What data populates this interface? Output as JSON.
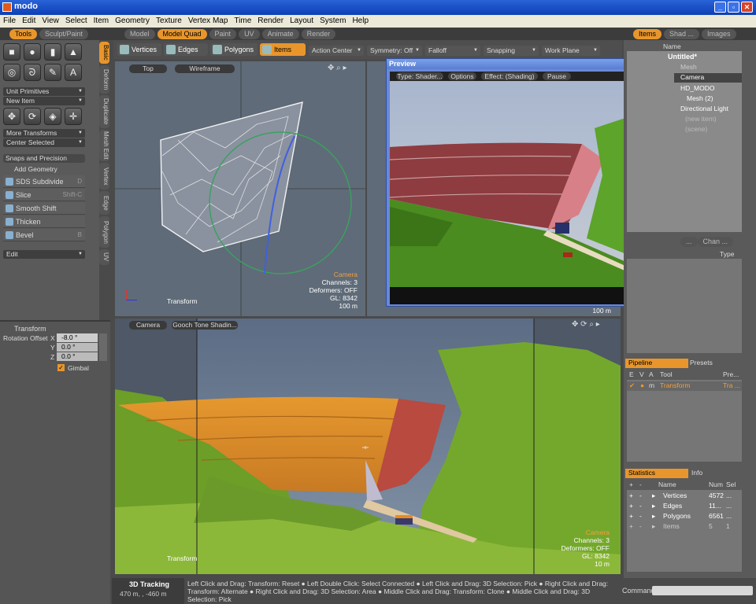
{
  "window": {
    "title": "modo",
    "min": "_",
    "max": "▫",
    "close": "✕"
  },
  "menu": [
    "File",
    "Edit",
    "View",
    "Select",
    "Item",
    "Geometry",
    "Texture",
    "Vertex Map",
    "Time",
    "Render",
    "Layout",
    "System",
    "Help"
  ],
  "left_tabs": [
    "Tools",
    "Sculpt/Paint"
  ],
  "layout_tabs": [
    "Model",
    "Model Quad",
    "Paint",
    "UV",
    "Animate",
    "Render"
  ],
  "right_tabs": [
    "Items",
    "Shad ...",
    "Images"
  ],
  "vertical_tabs": [
    "Basic",
    "Deform",
    "Duplicate",
    "Mesh Edit",
    "Vertex",
    "Edge",
    "Polygon",
    "UV"
  ],
  "toolbox": {
    "unit_primitives": "Unit Primitives",
    "new_item": "New Item",
    "more_transforms": "More Transforms",
    "center_selected": "Center Selected",
    "snaps": "Snaps and Precision",
    "add_geometry": "Add Geometry",
    "tools": [
      {
        "label": "SDS Subdivide",
        "key": "D"
      },
      {
        "label": "Slice",
        "key": "Shift-C"
      },
      {
        "label": "Smooth Shift",
        "key": ""
      },
      {
        "label": "Thicken",
        "key": ""
      },
      {
        "label": "Bevel",
        "key": "B"
      }
    ],
    "edit": "Edit"
  },
  "transform_panel": {
    "title": "Transform",
    "rot_label": "Rotation Offset",
    "x": "-8.0 °",
    "y": "0.0 °",
    "z": "0.0 °",
    "gimbal": "Gimbal"
  },
  "modes": [
    "Vertices",
    "Edges",
    "Polygons",
    "Items"
  ],
  "toolbar_drops": [
    "Action Center",
    "Symmetry: Off",
    "Falloff",
    "Snapping",
    "Work Plane"
  ],
  "viewport_top": {
    "view": "Top",
    "shading": "Wireframe",
    "info": [
      "Camera",
      "Channels: 3",
      "Deformers: OFF",
      "GL: 8342",
      "100 m"
    ],
    "tool": "Transform"
  },
  "viewport_right": {
    "distance": "100 m"
  },
  "viewport_bottom": {
    "view": "Camera",
    "shading": "Gooch Tone Shadin...",
    "info": [
      "Camera",
      "Channels: 3",
      "Deformers: OFF",
      "GL: 8342",
      "10 m"
    ],
    "tool": "Transform"
  },
  "preview": {
    "title": "Preview",
    "buttons": [
      "Type: Shader...",
      "Options",
      "Effect: (Shading)",
      "Pause"
    ]
  },
  "items": {
    "col": "Name",
    "rows": [
      "Untitled*",
      "Mesh",
      "Camera",
      "HD_MODO",
      "Mesh (2)",
      "Directional Light",
      "(new item)",
      "(scene)"
    ]
  },
  "chan_tabs": [
    "...",
    "Chan ..."
  ],
  "chan_col": "Type",
  "pipeline": {
    "tabs": [
      "Pipeline",
      "Presets"
    ],
    "headers": [
      "E",
      "V",
      "A",
      "Tool",
      "Pre..."
    ],
    "row": {
      "m": "m",
      "tool": "Transform",
      "pre": "Tra ..."
    }
  },
  "statistics": {
    "tabs": [
      "Statistics",
      "Info"
    ],
    "headers": [
      "Name",
      "Num",
      "Sel"
    ],
    "rows": [
      {
        "name": "Vertices",
        "num": "4572",
        "sel": "..."
      },
      {
        "name": "Edges",
        "num": "11...",
        "sel": "..."
      },
      {
        "name": "Polygons",
        "num": "6561",
        "sel": "..."
      },
      {
        "name": "Items",
        "num": "5",
        "sel": "1"
      }
    ]
  },
  "command_label": "Command",
  "status": {
    "mode": "3D Tracking",
    "coords": "470 m, , -460 m",
    "help": "Left Click and Drag: Transform: Reset ● Left Double Click: Select Connected ● Left Click and Drag: 3D Selection: Pick ● Right Click and Drag: Transform: Alternate ● Right Click and Drag: 3D Selection: Area ● Middle Click and Drag: Transform: Clone ● Middle Click and Drag: 3D Selection: Pick"
  }
}
